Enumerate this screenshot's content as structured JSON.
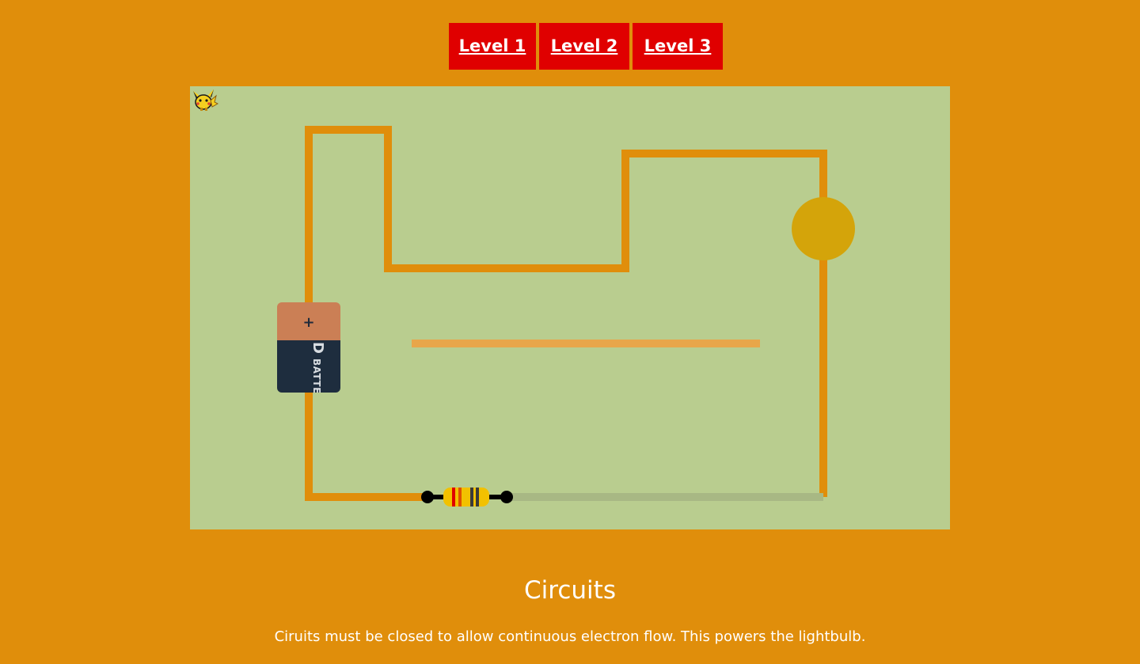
{
  "nav": {
    "levels": [
      {
        "label": "Level 1"
      },
      {
        "label": "Level 2"
      },
      {
        "label": "Level 3"
      }
    ]
  },
  "circuit": {
    "battery": {
      "plus": "+",
      "letter": "D",
      "label": "BATTERY"
    },
    "wire_color": "#e08e0b",
    "board_color": "#b9cd8f",
    "bulb_color": "#d4a40a",
    "loose_wire_color": "#e8a64a",
    "resistor_bands": [
      "#e00000",
      "#e05000",
      "#3a3a3a",
      "#3a3a3a"
    ]
  },
  "info": {
    "title": "Circuits",
    "description": "Ciruits must be closed to allow continuous electron flow. This powers the lightbulb."
  }
}
